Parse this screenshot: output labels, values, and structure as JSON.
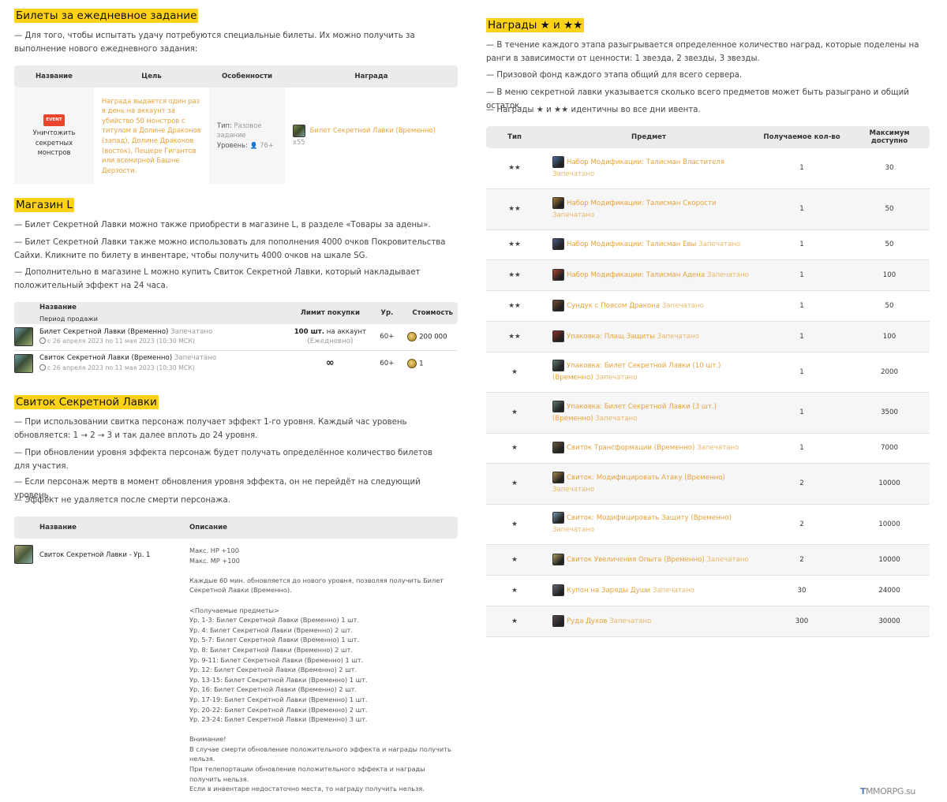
{
  "daily": {
    "title": "Билеты за ежедневное задание",
    "intro": "— Для того, чтобы испытать удачу потребуются специальные билеты. Их можно получить за выполнение нового ежедневного задания:",
    "headers": [
      "Название",
      "Цель",
      "Особенности",
      "Награда"
    ],
    "row": {
      "badge": "EVENT",
      "name": "Уничтожить секретных монстров",
      "goal": "Награда выдается один раз в день на аккаунт за убийство 50 монстров с титулом в Долине Драконов (запад), Долине Драконов (восток), Пещере Гигантов или всемирной Башне Дерзости.",
      "type_label": "Тип:",
      "type_value": "Разовое задание",
      "level_label": "Уровень:",
      "level_value": "76+",
      "reward_item": "Билет Секретной Лавки (Временно)",
      "reward_qty": "x55"
    }
  },
  "shop": {
    "title": "Магазин L",
    "p1": "— Билет Секретной Лавки можно также приобрести в магазине L, в разделе «Товары за адены».",
    "p2": "— Билет Секретной Лавки также можно использовать для пополнения 4000 очков Покровительства Сайхи. Кликните по билету в инвентаре, чтобы получить 4000 очков на шкале SG.",
    "p3": "— Дополнительно в магазине L можно купить Свиток Секретной Лавки, который накладывает положительный эффект на 24 часа.",
    "headers": {
      "name": "Название",
      "period": "Период продажи",
      "limit": "Лимит покупки",
      "level": "Ур.",
      "cost": "Стоимость"
    },
    "rows": [
      {
        "item": "Билет Секретной Лавки (Временно)",
        "sealed": "Запечатано",
        "period": "с 26 апреля 2023 по 11 мая 2023 (10:30 МСК)",
        "limit_bold": "100 шт.",
        "limit_rest": "на аккаунт",
        "limit_note": "(Ежедневно)",
        "level": "60+",
        "cost": "200 000"
      },
      {
        "item": "Свиток Секретной Лавки (Временно)",
        "sealed": "Запечатано",
        "period": "с 26 апреля 2023 по 11 мая 2023 (10:30 МСК)",
        "limit_bold": "∞",
        "limit_rest": "",
        "limit_note": "",
        "level": "60+",
        "cost": "1"
      }
    ]
  },
  "scroll": {
    "title": "Свиток Секретной Лавки",
    "p1": "— При использовании свитка персонаж получает эффект 1-го уровня. Каждый час уровень обновляется: 1 → 2 → 3 и так далее вплоть до 24 уровня.",
    "p2": "— При обновлении уровня эффекта персонаж будет получать определённое количество билетов для участия.",
    "p3": "— Если персонаж мертв в момент обновления уровня эффекта, он не перейдёт на следующий уровень.",
    "p4": "— Эффект не удаляется после смерти персонажа.",
    "headers": [
      "Название",
      "Описание"
    ],
    "name": "Свиток Секретной Лавки - Ур. 1",
    "desc": [
      "Макс. HP +100",
      "Макс. MP +100",
      "",
      "Каждые 60 мин. обновляется до нового уровня, позволяя получить Билет Секретной Лавки (Временно).",
      "",
      "<Получаемые предметы>",
      "Ур. 1-3: Билет Секретной Лавки (Временно) 1 шт.",
      "Ур. 4: Билет Секретной Лавки (Временно) 2 шт.",
      "Ур. 5-7: Билет Секретной Лавки (Временно) 1 шт.",
      "Ур. 8: Билет Секретной Лавки (Временно) 2 шт.",
      "Ур. 9-11: Билет Секретной Лавки (Временно) 1 шт.",
      "Ур. 12: Билет Секретной Лавки (Временно) 2 шт.",
      "Ур. 13-15: Билет Секретной Лавки (Временно) 1 шт.",
      "Ур. 16: Билет Секретной Лавки (Временно) 2 шт.",
      "Ур. 17-19: Билет Секретной Лавки (Временно) 1 шт.",
      "Ур. 20-22: Билет Секретной Лавки (Временно) 2 шт.",
      "Ур. 23-24: Билет Секретной Лавки (Временно) 3 шт.",
      "",
      "Внимание!",
      "В случае смерти обновление положительного эффекта и награды получить нельзя.",
      "При телепортации обновление положительного эффекта и награды получить нельзя.",
      "Если в инвентаре недостаточно места, то награду получить нельзя."
    ]
  },
  "rewards": {
    "title": "Награды ★ и ★★",
    "p1": "— В течение каждого этапа разыгрывается определенное количество наград, которые поделены на ранги в зависимости от ценности: 1 звезда, 2 звезды, 3 звезды.",
    "p2": "— Призовой фонд каждого этапа общий для всего сервера.",
    "p3": "— В меню секретной лавки указывается сколько всего предметов может быть разыграно и общий остаток.",
    "p4": "— Награды ★ и ★★ идентичны во все дни ивента.",
    "headers": [
      "Тип",
      "Предмет",
      "Получаемое кол-во",
      "Максимум доступно"
    ],
    "sealed": "Запечатано",
    "rows": [
      {
        "type": "★★",
        "item1": "Набор Модификации: Талисман Властителя",
        "item2": "",
        "sealed_wrap": true,
        "qty": "1",
        "max": "30",
        "h": 51,
        "color": "#4a6fa8"
      },
      {
        "type": "★★",
        "item1": "Набор Модификации: Талисман Скорости",
        "item2": "",
        "sealed_wrap": true,
        "qty": "1",
        "max": "50",
        "h": 52,
        "color": "#a8792a"
      },
      {
        "type": "★★",
        "item1": "Набор Модификации: Талисман Евы",
        "item2": "",
        "sealed_wrap": false,
        "qty": "1",
        "max": "50",
        "h": 38,
        "color": "#4a5a8a"
      },
      {
        "type": "★★",
        "item1": "Набор Модификации: Талисман Адена",
        "item2": "",
        "sealed_wrap": false,
        "qty": "1",
        "max": "100",
        "h": 39,
        "color": "#b0442a"
      },
      {
        "type": "★★",
        "item1": "Сундук с Поясом Дракона",
        "item2": "",
        "sealed_wrap": false,
        "qty": "1",
        "max": "50",
        "h": 39,
        "color": "#7a4a2a"
      },
      {
        "type": "★★",
        "item1": "Упаковка: Плащ Защиты",
        "item2": "",
        "sealed_wrap": false,
        "qty": "1",
        "max": "100",
        "h": 39,
        "color": "#9a2a2a"
      },
      {
        "type": "★",
        "item1": "Упаковка: Билет Секретной Лавки (10 шт.)",
        "item2": "(Временно)",
        "sealed_wrap": false,
        "qty": "1",
        "max": "2000",
        "h": 51,
        "color": "#5a7a6a"
      },
      {
        "type": "★",
        "item1": "Упаковка: Билет Секретной Лавки (3 шт.)",
        "item2": "(Временно)",
        "sealed_wrap": false,
        "qty": "1",
        "max": "3500",
        "h": 52,
        "color": "#5a7a6a"
      },
      {
        "type": "★",
        "item1": "Свиток Трансформации (Временно)",
        "item2": "",
        "sealed_wrap": false,
        "qty": "1",
        "max": "7000",
        "h": 38,
        "color": "#6a5a3a"
      },
      {
        "type": "★",
        "item1": "Свиток: Модифицировать Атаку (Временно)",
        "item2": "",
        "sealed_wrap": true,
        "qty": "2",
        "max": "10000",
        "h": 52,
        "color": "#b08a4a"
      },
      {
        "type": "★",
        "item1": "Свиток: Модифицировать Защиту (Временно)",
        "item2": "",
        "sealed_wrap": true,
        "qty": "2",
        "max": "10000",
        "h": 51,
        "color": "#7a9ab0"
      },
      {
        "type": "★",
        "item1": "Свиток Увеличения Опыта (Временно)",
        "item2": "",
        "sealed_wrap": false,
        "qty": "2",
        "max": "10000",
        "h": 39,
        "color": "#b0a05a"
      },
      {
        "type": "★",
        "item1": "Купон на Заряды Души",
        "item2": "",
        "sealed_wrap": false,
        "qty": "30",
        "max": "24000",
        "h": 39,
        "color": "#6a6a7a"
      },
      {
        "type": "★",
        "item1": "Руда Духов",
        "item2": "",
        "sealed_wrap": false,
        "qty": "300",
        "max": "30000",
        "h": 39,
        "color": "#5a4a4a"
      }
    ]
  },
  "watermark": {
    "prefix": "T",
    "site": "MMORPG.su"
  }
}
